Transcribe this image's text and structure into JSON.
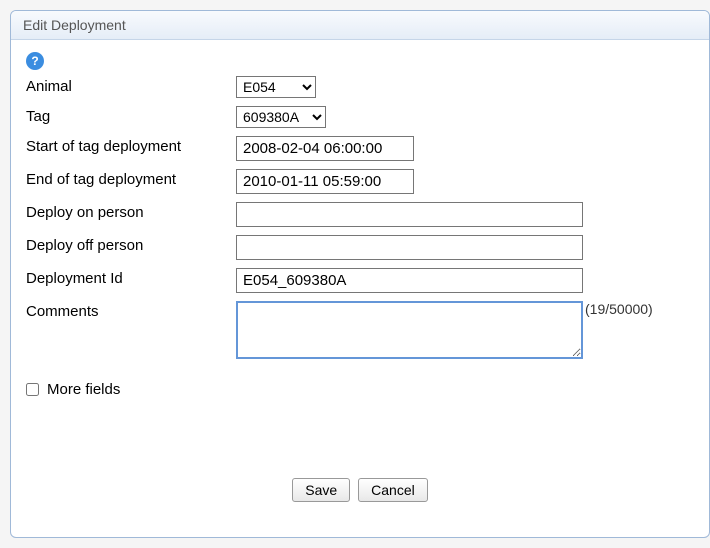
{
  "dialog": {
    "title": "Edit Deployment"
  },
  "form": {
    "animal": {
      "label": "Animal",
      "value": "E054"
    },
    "tag": {
      "label": "Tag",
      "value": "609380A"
    },
    "start": {
      "label": "Start of tag deployment",
      "value": "2008-02-04 06:00:00"
    },
    "end": {
      "label": "End of tag deployment",
      "value": "2010-01-11 05:59:00"
    },
    "deploy_on": {
      "label": "Deploy on person",
      "value": ""
    },
    "deploy_off": {
      "label": "Deploy off person",
      "value": ""
    },
    "deployment_id": {
      "label": "Deployment Id",
      "value": "E054_609380A"
    },
    "comments": {
      "label": "Comments",
      "value": "",
      "counter": "(19/50000)"
    },
    "more_fields": {
      "label": "More fields"
    }
  },
  "buttons": {
    "save": "Save",
    "cancel": "Cancel"
  }
}
